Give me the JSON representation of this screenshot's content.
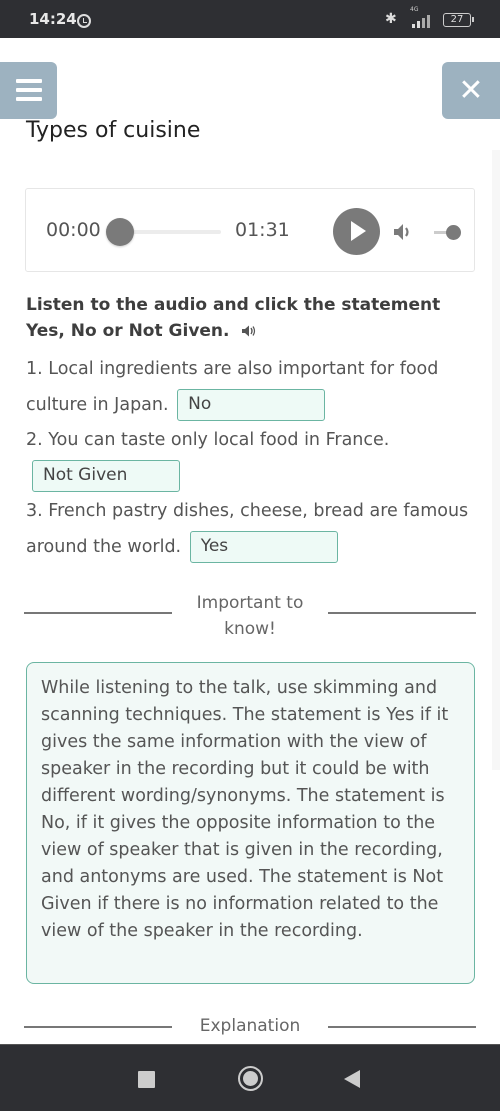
{
  "status_bar": {
    "time": "14:24",
    "network": "4G",
    "battery": "27"
  },
  "header": {
    "menu_icon": "hamburger-menu-icon",
    "close_icon": "close-icon",
    "close_glyph": "✕",
    "title": "Types of cuisine"
  },
  "audio_player": {
    "current_time": "00:00",
    "total_time": "01:31",
    "progress_fraction": 0,
    "volume_fraction": 1,
    "play_icon": "play-icon",
    "volume_icon": "speaker-icon"
  },
  "instructions": {
    "text": "Listen to the audio and click the statement Yes, No or Not Given.",
    "audio_icon": "speaker-icon"
  },
  "questions": [
    {
      "number": "1.",
      "text": "Local ingredients are also important for food culture in Japan.",
      "answer": "No"
    },
    {
      "number": "2.",
      "text": "You can taste only local food in France.",
      "answer": "Not Given"
    },
    {
      "number": "3.",
      "text": "French pastry dishes, cheese, bread are famous around the world.",
      "answer": "Yes"
    }
  ],
  "important": {
    "heading": "Important to know!",
    "body": "While listening to the talk, use skimming and scanning techniques. The statement is Yes if it gives the same information with the view of speaker in the recording but it could be with different wording/synonyms. The statement is No, if it gives the opposite information to the view of speaker that is given in the recording, and antonyms are used. The statement is Not Given if there is no information related to the view of the speaker in the recording."
  },
  "explanation": {
    "heading": "Explanation"
  },
  "nav_bar": {
    "recents_icon": "recents-square-icon",
    "home_icon": "home-circle-icon",
    "back_icon": "back-triangle-icon"
  },
  "colors": {
    "accent_button": "#9db2c0",
    "answer_border": "#6bb5a2",
    "answer_fill": "#eefaf6",
    "system_bar": "#2e2f33"
  }
}
